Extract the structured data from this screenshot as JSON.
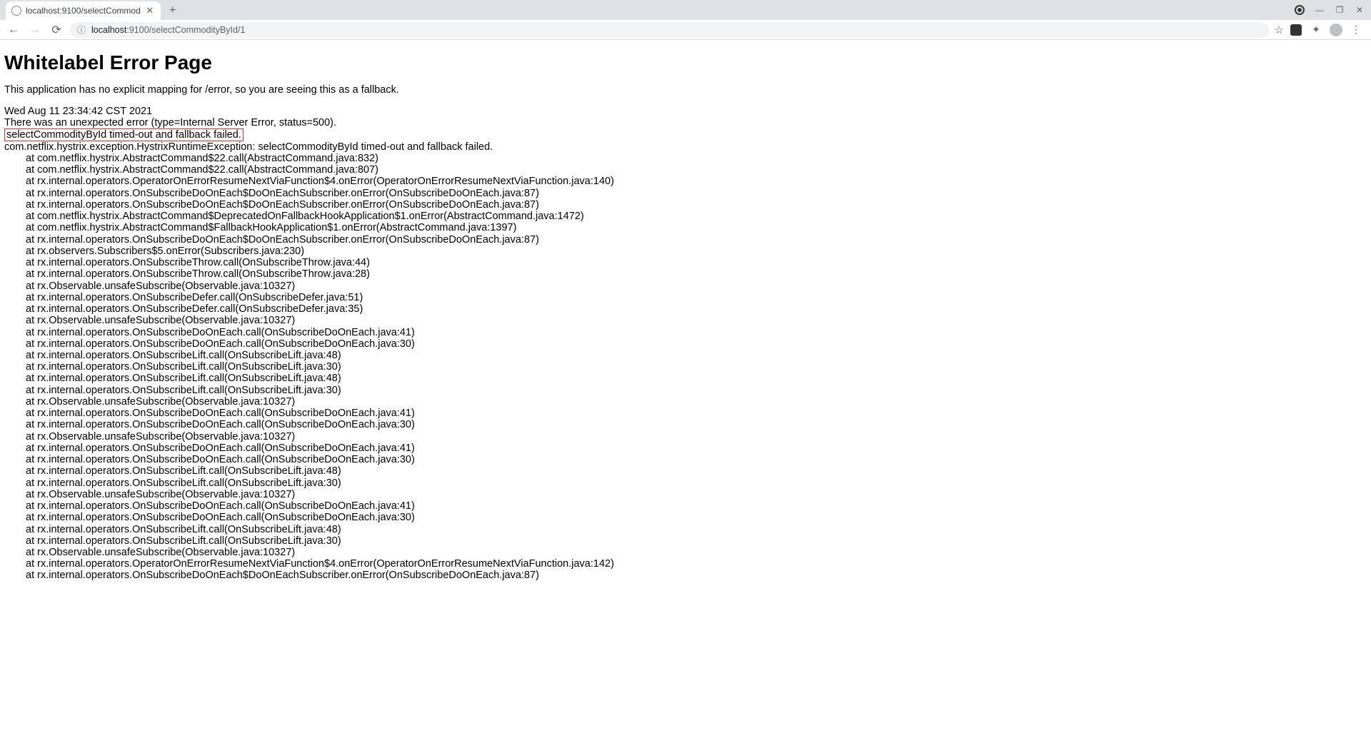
{
  "browser": {
    "tab_title": "localhost:9100/selectCommod",
    "url_host": "localhost",
    "url_port_path": ":9100/selectCommodityById/1"
  },
  "page": {
    "heading": "Whitelabel Error Page",
    "fallback_message": "This application has no explicit mapping for /error, so you are seeing this as a fallback.",
    "timestamp": "Wed Aug 11 23:34:42 CST 2021",
    "error_type_line": "There was an unexpected error (type=Internal Server Error, status=500).",
    "highlighted_line": "selectCommodityById timed-out and fallback failed.",
    "exception_header": "com.netflix.hystrix.exception.HystrixRuntimeException: selectCommodityById timed-out and fallback failed.",
    "stack_trace": [
      "at com.netflix.hystrix.AbstractCommand$22.call(AbstractCommand.java:832)",
      "at com.netflix.hystrix.AbstractCommand$22.call(AbstractCommand.java:807)",
      "at rx.internal.operators.OperatorOnErrorResumeNextViaFunction$4.onError(OperatorOnErrorResumeNextViaFunction.java:140)",
      "at rx.internal.operators.OnSubscribeDoOnEach$DoOnEachSubscriber.onError(OnSubscribeDoOnEach.java:87)",
      "at rx.internal.operators.OnSubscribeDoOnEach$DoOnEachSubscriber.onError(OnSubscribeDoOnEach.java:87)",
      "at com.netflix.hystrix.AbstractCommand$DeprecatedOnFallbackHookApplication$1.onError(AbstractCommand.java:1472)",
      "at com.netflix.hystrix.AbstractCommand$FallbackHookApplication$1.onError(AbstractCommand.java:1397)",
      "at rx.internal.operators.OnSubscribeDoOnEach$DoOnEachSubscriber.onError(OnSubscribeDoOnEach.java:87)",
      "at rx.observers.Subscribers$5.onError(Subscribers.java:230)",
      "at rx.internal.operators.OnSubscribeThrow.call(OnSubscribeThrow.java:44)",
      "at rx.internal.operators.OnSubscribeThrow.call(OnSubscribeThrow.java:28)",
      "at rx.Observable.unsafeSubscribe(Observable.java:10327)",
      "at rx.internal.operators.OnSubscribeDefer.call(OnSubscribeDefer.java:51)",
      "at rx.internal.operators.OnSubscribeDefer.call(OnSubscribeDefer.java:35)",
      "at rx.Observable.unsafeSubscribe(Observable.java:10327)",
      "at rx.internal.operators.OnSubscribeDoOnEach.call(OnSubscribeDoOnEach.java:41)",
      "at rx.internal.operators.OnSubscribeDoOnEach.call(OnSubscribeDoOnEach.java:30)",
      "at rx.internal.operators.OnSubscribeLift.call(OnSubscribeLift.java:48)",
      "at rx.internal.operators.OnSubscribeLift.call(OnSubscribeLift.java:30)",
      "at rx.internal.operators.OnSubscribeLift.call(OnSubscribeLift.java:48)",
      "at rx.internal.operators.OnSubscribeLift.call(OnSubscribeLift.java:30)",
      "at rx.Observable.unsafeSubscribe(Observable.java:10327)",
      "at rx.internal.operators.OnSubscribeDoOnEach.call(OnSubscribeDoOnEach.java:41)",
      "at rx.internal.operators.OnSubscribeDoOnEach.call(OnSubscribeDoOnEach.java:30)",
      "at rx.Observable.unsafeSubscribe(Observable.java:10327)",
      "at rx.internal.operators.OnSubscribeDoOnEach.call(OnSubscribeDoOnEach.java:41)",
      "at rx.internal.operators.OnSubscribeDoOnEach.call(OnSubscribeDoOnEach.java:30)",
      "at rx.internal.operators.OnSubscribeLift.call(OnSubscribeLift.java:48)",
      "at rx.internal.operators.OnSubscribeLift.call(OnSubscribeLift.java:30)",
      "at rx.Observable.unsafeSubscribe(Observable.java:10327)",
      "at rx.internal.operators.OnSubscribeDoOnEach.call(OnSubscribeDoOnEach.java:41)",
      "at rx.internal.operators.OnSubscribeDoOnEach.call(OnSubscribeDoOnEach.java:30)",
      "at rx.internal.operators.OnSubscribeLift.call(OnSubscribeLift.java:48)",
      "at rx.internal.operators.OnSubscribeLift.call(OnSubscribeLift.java:30)",
      "at rx.Observable.unsafeSubscribe(Observable.java:10327)",
      "at rx.internal.operators.OperatorOnErrorResumeNextViaFunction$4.onError(OperatorOnErrorResumeNextViaFunction.java:142)",
      "at rx.internal.operators.OnSubscribeDoOnEach$DoOnEachSubscriber.onError(OnSubscribeDoOnEach.java:87)"
    ]
  }
}
